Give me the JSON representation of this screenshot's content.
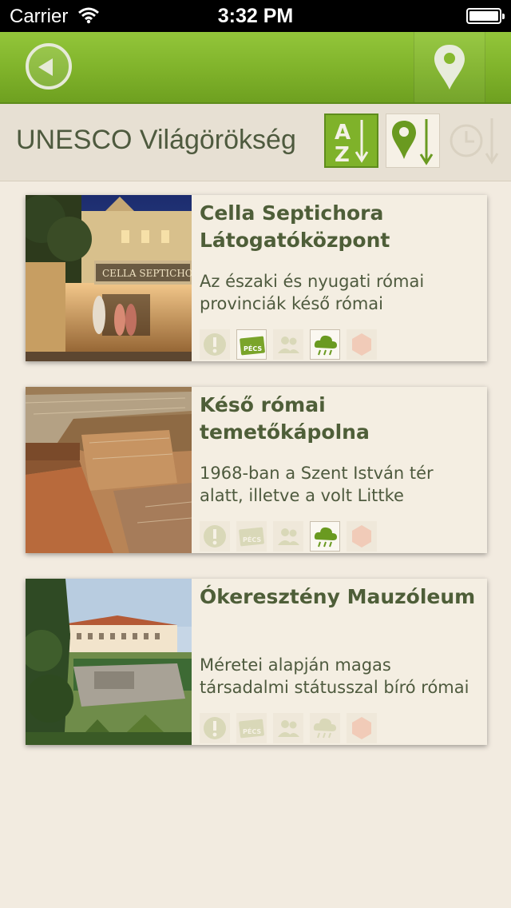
{
  "status": {
    "carrier": "Carrier",
    "time": "3:32 PM"
  },
  "nav": {
    "back_icon": "back-arrow-icon",
    "map_icon": "map-pin-icon"
  },
  "header": {
    "title": "UNESCO Világörökség",
    "sort_options": [
      {
        "name": "alphabetical-sort-icon",
        "active": true
      },
      {
        "name": "distance-sort-icon",
        "active": false
      },
      {
        "name": "time-sort-icon",
        "active": false,
        "disabled": true
      }
    ]
  },
  "cards": [
    {
      "title": "Cella Septichora Látogatóközpont",
      "desc_line1": "Az északi és nyugati római",
      "desc_line2": "provinciák késő római",
      "photo_sign": "CELLA SEPTICHORA",
      "tags": {
        "info": false,
        "pecs_card": true,
        "group": false,
        "rain": true,
        "hex": false
      }
    },
    {
      "title": "Késő római temetőkápolna",
      "desc_line1": "1968-ban a Szent István tér",
      "desc_line2": "alatt, illetve a volt Littke",
      "tags": {
        "info": false,
        "pecs_card": false,
        "group": false,
        "rain": true,
        "hex": false
      }
    },
    {
      "title": "Ókeresztény Mauzóleum",
      "desc_line1": "Méretei alapján magas",
      "desc_line2": "társadalmi státusszal bíró római",
      "tags": {
        "info": false,
        "pecs_card": false,
        "group": false,
        "rain": false,
        "hex": false
      }
    }
  ],
  "tag_label_pecs": "PÉCS",
  "colors": {
    "accent": "#7fb22a",
    "accent_dark": "#5e8c1c",
    "background": "#f2ebe0",
    "title_text": "#4e5e38"
  }
}
